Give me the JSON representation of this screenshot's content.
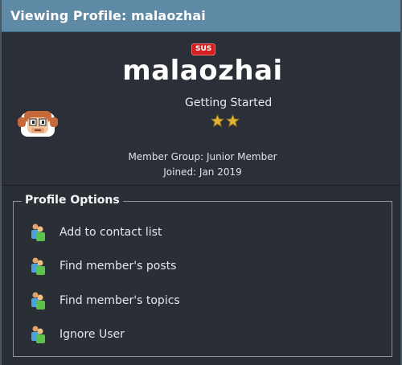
{
  "header": {
    "title": "Viewing Profile: malaozhai"
  },
  "profile": {
    "badge": "SUS",
    "username": "malaozhai",
    "rank_title": "Getting Started",
    "rank_stars": 2,
    "member_group": "Member Group: Junior Member",
    "joined": "Joined: Jan 2019"
  },
  "options": {
    "legend": "Profile Options",
    "items": [
      {
        "label": "Add to contact list",
        "icon": "users-icon"
      },
      {
        "label": "Find member's posts",
        "icon": "users-icon"
      },
      {
        "label": "Find member's topics",
        "icon": "users-icon"
      },
      {
        "label": "Ignore User",
        "icon": "users-icon"
      }
    ]
  },
  "colors": {
    "header_bg": "#5e8aa6",
    "page_bg": "#2a2f36",
    "badge_bg": "#d62020",
    "star": "#e2b23a"
  }
}
